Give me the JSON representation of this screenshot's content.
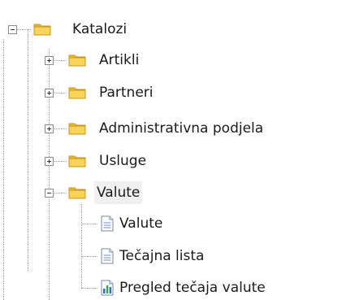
{
  "tree": {
    "root": {
      "label": "Katalozi",
      "expanded": true,
      "icon": "folder-icon"
    },
    "children": [
      {
        "label": "Artikli",
        "expanded": false,
        "icon": "folder-icon"
      },
      {
        "label": "Partneri",
        "expanded": false,
        "icon": "folder-icon"
      },
      {
        "label": "Administrativna podjela",
        "expanded": false,
        "icon": "folder-icon"
      },
      {
        "label": "Usluge",
        "expanded": false,
        "icon": "folder-icon"
      },
      {
        "label": "Valute",
        "expanded": true,
        "selected": true,
        "icon": "folder-icon",
        "children": [
          {
            "label": "Valute",
            "icon": "document-icon"
          },
          {
            "label": "Tečajna lista",
            "icon": "document-icon"
          },
          {
            "label": "Pregled tečaja valute",
            "icon": "report-chart-icon"
          }
        ]
      }
    ]
  },
  "colors": {
    "folder_fill": "#f7d35a",
    "folder_tab": "#e8b933",
    "folder_edge": "#c9961e",
    "selection_bg": "#f0f0f0",
    "doc_line": "#6d8fc7",
    "chart_bar_blue": "#2f6fc4",
    "chart_bar_green": "#3aa84a"
  }
}
